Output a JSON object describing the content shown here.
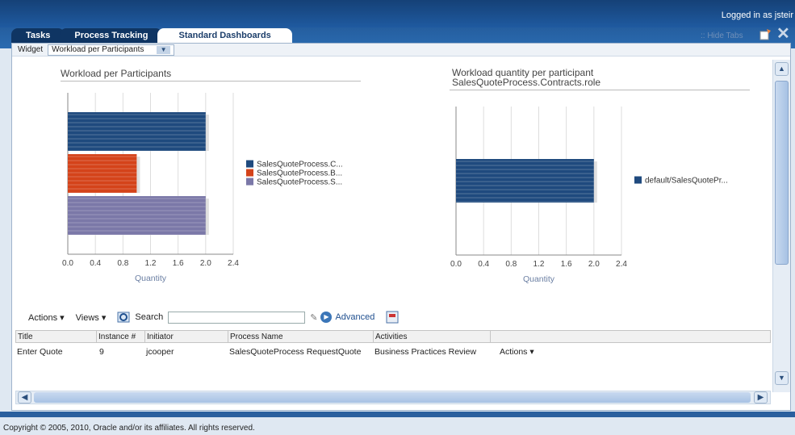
{
  "header": {
    "logged_in": "Logged in as jsteir"
  },
  "tabs": [
    {
      "label": "Tasks"
    },
    {
      "label": "Process Tracking"
    },
    {
      "label": "Standard Dashboards"
    }
  ],
  "hide_tabs": ":: Hide Tabs",
  "widget": {
    "label": "Widget",
    "selected": "Workload per Participants"
  },
  "charts": {
    "left_title": "Workload per Participants",
    "right_title_line1": "Workload quantity per participant",
    "right_title_line2": "SalesQuoteProcess.Contracts.role"
  },
  "chart_data": [
    {
      "type": "bar",
      "orientation": "horizontal",
      "title": "Workload per Participants",
      "xlabel": "Quantity",
      "xlim": [
        0,
        2.4
      ],
      "xticks": [
        "0.0",
        "0.4",
        "0.8",
        "1.2",
        "1.6",
        "2.0",
        "2.4"
      ],
      "series": [
        {
          "name": "SalesQuoteProcess.C...",
          "value": 2,
          "color": "#1f4a7e"
        },
        {
          "name": "SalesQuoteProcess.B...",
          "value": 1,
          "color": "#d4431a"
        },
        {
          "name": "SalesQuoteProcess.S...",
          "value": 2,
          "color": "#7b78a8"
        }
      ],
      "legend": "right"
    },
    {
      "type": "bar",
      "orientation": "horizontal",
      "title": "Workload quantity per participant SalesQuoteProcess.Contracts.role",
      "xlabel": "Quantity",
      "xlim": [
        0,
        2.4
      ],
      "xticks": [
        "0.0",
        "0.4",
        "0.8",
        "1.2",
        "1.6",
        "2.0",
        "2.4"
      ],
      "series": [
        {
          "name": "default/SalesQuotePr...",
          "value": 2,
          "color": "#1f4a7e"
        }
      ],
      "legend": "right"
    }
  ],
  "toolbar": {
    "actions": "Actions ▾",
    "views": "Views ▾",
    "search_label": "Search",
    "advanced": "Advanced"
  },
  "table": {
    "columns": [
      "Title",
      "Instance #",
      "Initiator",
      "Process Name",
      "Activities",
      ""
    ],
    "rows": [
      [
        "Enter Quote",
        "9",
        "jcooper",
        "SalesQuoteProcess RequestQuote",
        "Business Practices Review",
        "Actions ▾"
      ]
    ]
  },
  "footer": {
    "copyright": "Copyright © 2005, 2010, Oracle and/or its affiliates. All rights reserved."
  }
}
